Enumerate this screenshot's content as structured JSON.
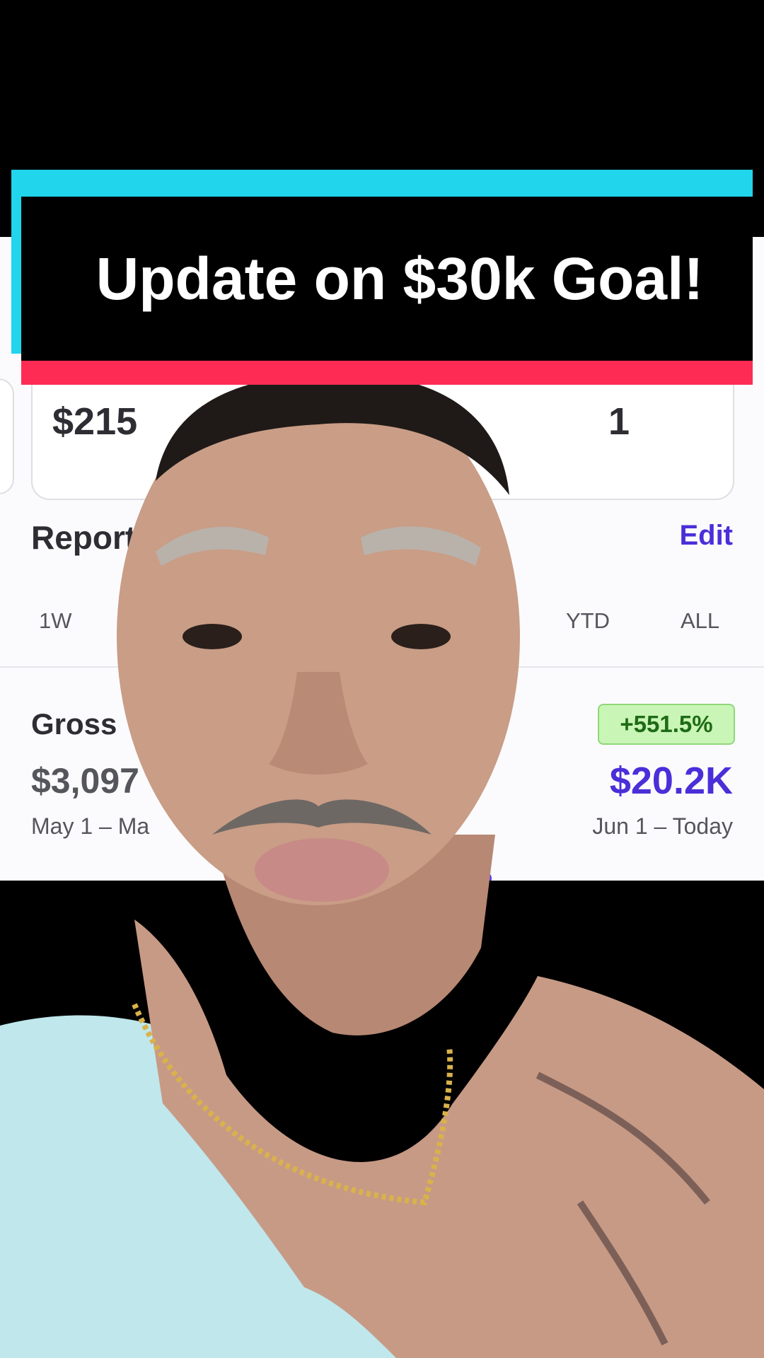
{
  "banner": {
    "title": "Update on $30k Goal!"
  },
  "dashboard": {
    "stat_left_value": "$215",
    "stat_right_value": "1",
    "section_title": "Report",
    "edit_label": "Edit",
    "tabs": [
      "1W",
      "YTD",
      "ALL"
    ],
    "metric": {
      "label": "Gross",
      "previous_value": "$3,097",
      "previous_range": "May 1 – Ma",
      "change_badge": "+551.5%",
      "current_value": "$20.2K",
      "current_range": "Jun 1 – Today"
    }
  },
  "colors": {
    "accent": "#4a2fd9",
    "banner_cyan": "#20d5ec",
    "banner_red": "#fe2c55",
    "badge_green_bg": "#c9f5b6"
  }
}
